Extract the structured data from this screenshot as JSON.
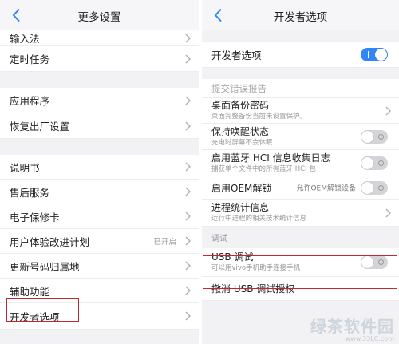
{
  "left": {
    "title": "更多设置",
    "items": [
      {
        "label": "输入法"
      },
      {
        "label": "定时任务"
      },
      {
        "label": "应用程序"
      },
      {
        "label": "恢复出厂设置"
      },
      {
        "label": "说明书"
      },
      {
        "label": "售后服务"
      },
      {
        "label": "电子保修卡"
      },
      {
        "label": "用户体验改进计划",
        "value": "已开启"
      },
      {
        "label": "更新号码归属地"
      },
      {
        "label": "辅助功能"
      },
      {
        "label": "开发者选项"
      }
    ]
  },
  "right": {
    "title": "开发者选项",
    "master_toggle": {
      "label": "开发者选项",
      "state": "on"
    },
    "bug_report": {
      "label": "提交错误报告"
    },
    "backup_password": {
      "label": "桌面备份密码",
      "sub": "桌面完整备份当前未设置保护。"
    },
    "stay_awake": {
      "label": "保持唤醒状态",
      "sub": "充电时屏幕不会休眠"
    },
    "bt_hci": {
      "label": "启用蓝牙 HCI 信息收集日志",
      "sub": "捕获单个文件中的所有蓝牙 HCI 包"
    },
    "oem": {
      "label": "启用OEM解锁",
      "value": "允许OEM解锁设备"
    },
    "process_stats": {
      "label": "进程统计信息",
      "sub": "运行中进程的相关技术统计信息"
    },
    "debug_section": "调试",
    "usb_debug": {
      "label": "USB 调试",
      "sub": "可以用vivo手机助手连接手机"
    },
    "revoke_usb": {
      "label": "撤消 USB 调试授权"
    }
  },
  "watermark": {
    "text": "绿茶软件园",
    "url": "www.33LC.com"
  },
  "colors": {
    "accent": "#2f86f6",
    "highlight": "#c0282e",
    "back": "#2f86f6"
  }
}
